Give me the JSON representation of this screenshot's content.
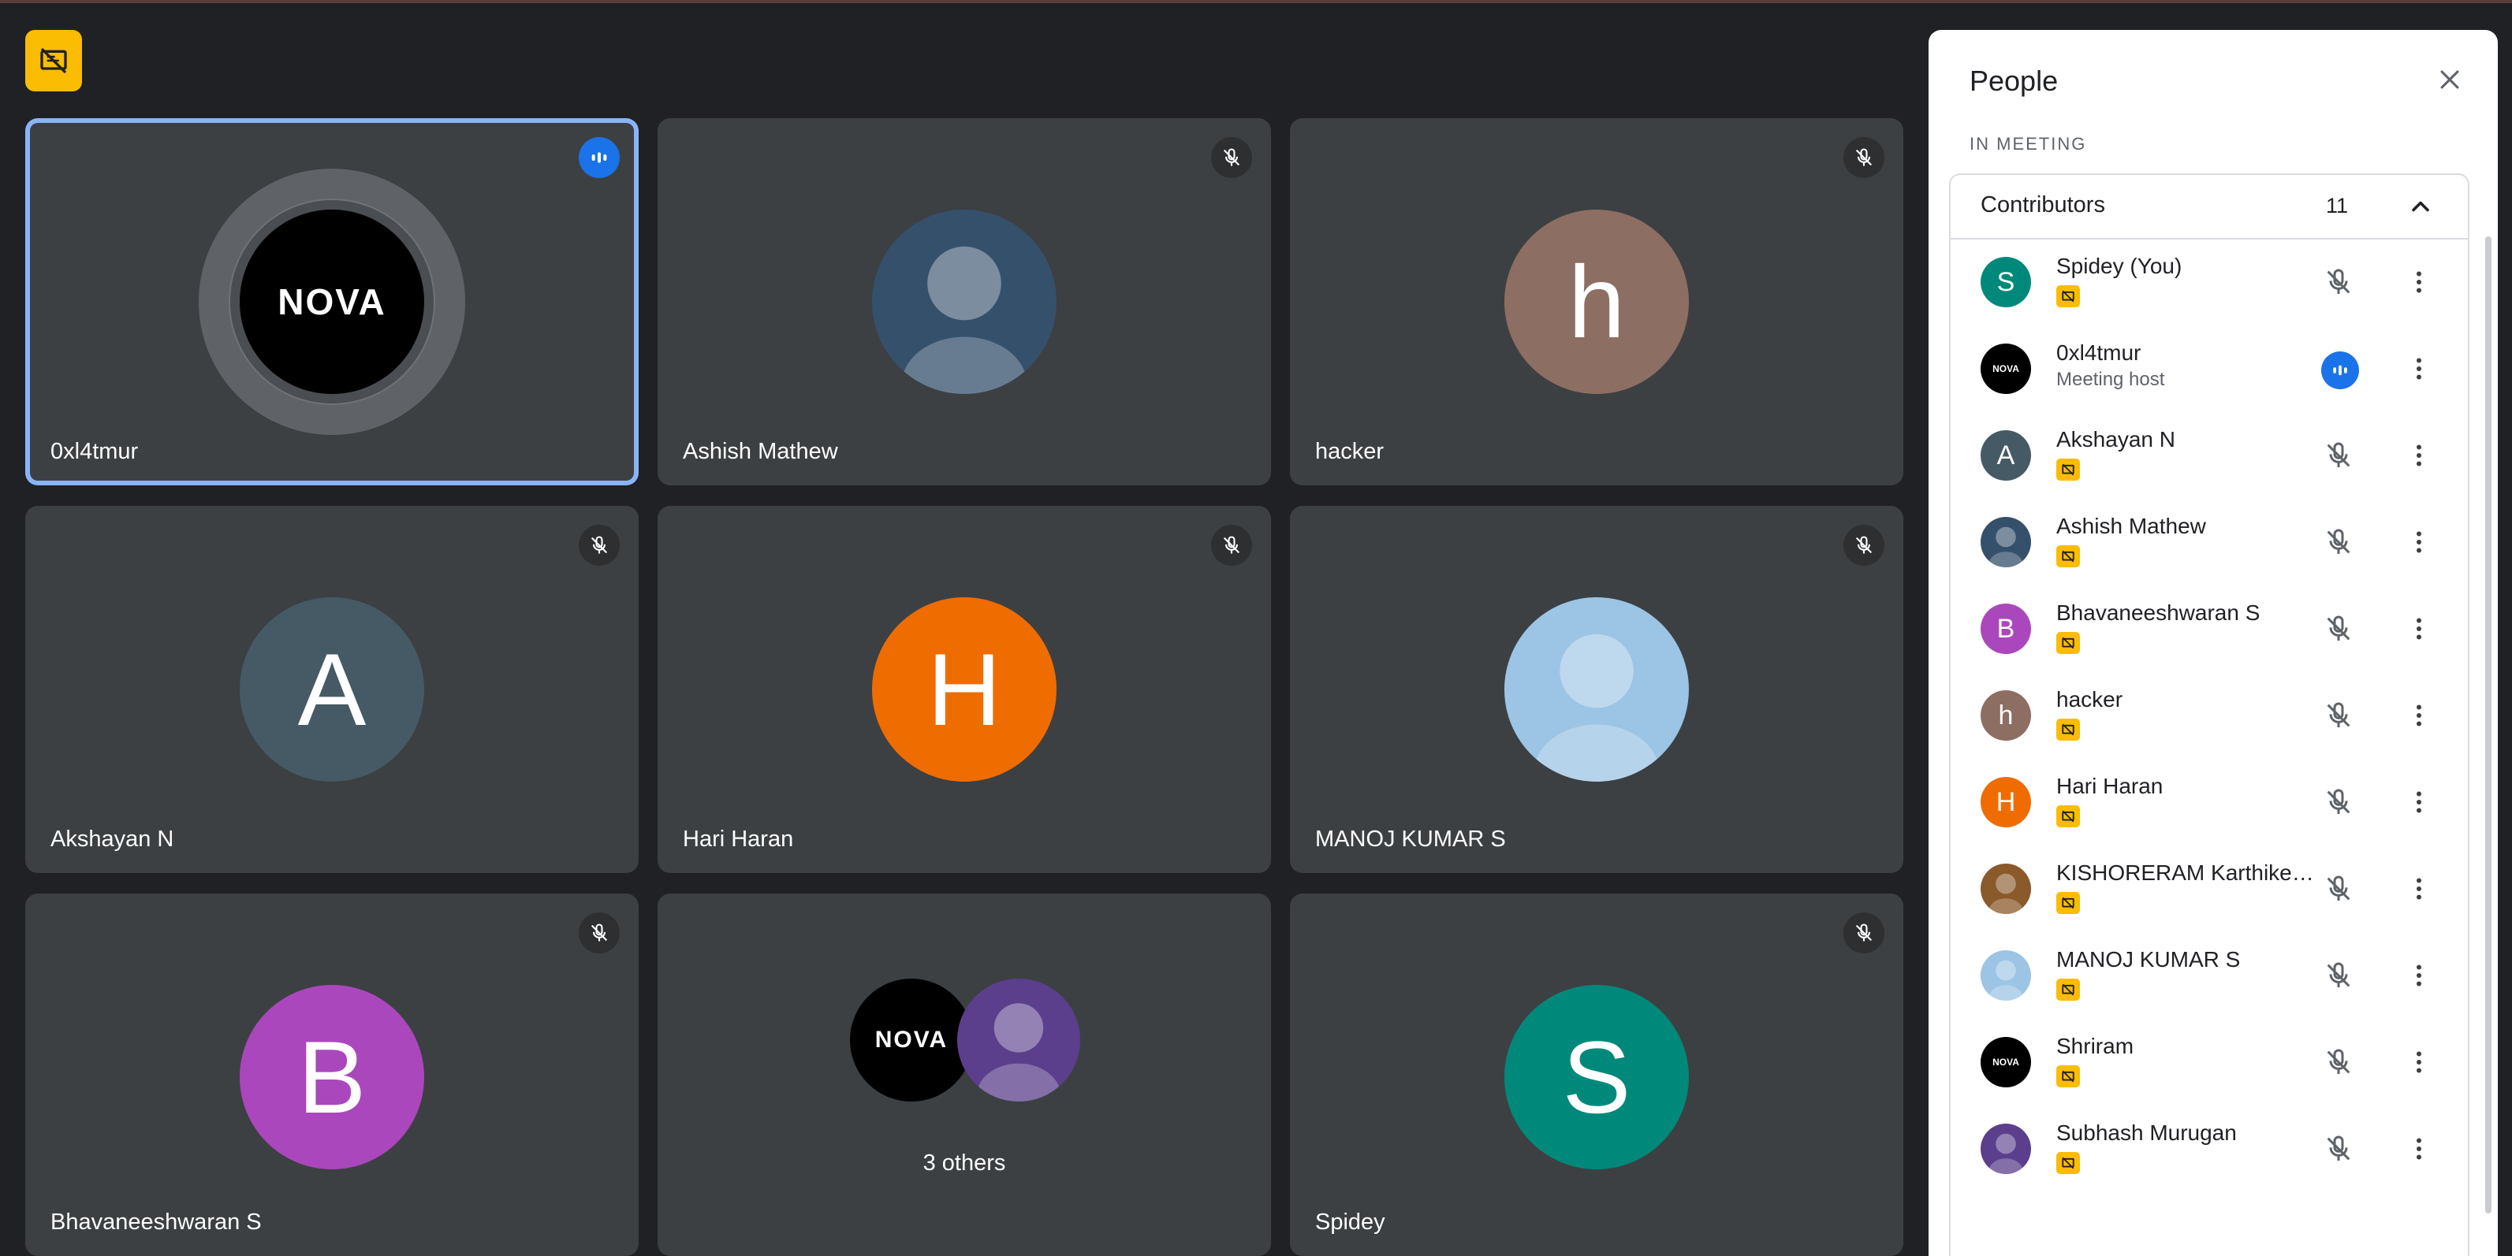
{
  "tiles": [
    {
      "name": "0xl4tmur",
      "avatar_type": "logo",
      "avatar_text": "NOVA",
      "status": "speaking",
      "active": true
    },
    {
      "name": "Ashish Mathew",
      "avatar_type": "image",
      "avatar_color": "#35506b",
      "status": "muted"
    },
    {
      "name": "hacker",
      "avatar_type": "letter",
      "avatar_text": "h",
      "avatar_color": "#8d6e63",
      "status": "muted"
    },
    {
      "name": "Akshayan N",
      "avatar_type": "letter",
      "avatar_text": "A",
      "avatar_color": "#455a64",
      "status": "muted"
    },
    {
      "name": "Hari Haran",
      "avatar_type": "letter",
      "avatar_text": "H",
      "avatar_color": "#ef6c00",
      "status": "muted"
    },
    {
      "name": "MANOJ KUMAR S",
      "avatar_type": "image",
      "avatar_color": "#9cc4e4",
      "status": "muted"
    },
    {
      "name": "Bhavaneeshwaran S",
      "avatar_type": "letter",
      "avatar_text": "B",
      "avatar_color": "#ab47bc",
      "status": "muted"
    },
    {
      "name": "",
      "avatar_type": "group",
      "group_label": "3 others",
      "status": "none"
    },
    {
      "name": "Spidey",
      "avatar_type": "letter",
      "avatar_text": "S",
      "avatar_color": "#00897b",
      "status": "muted"
    }
  ],
  "panel": {
    "title": "People",
    "section_label": "IN MEETING",
    "group_title": "Contributors",
    "group_count": "11"
  },
  "participants": [
    {
      "name": "Spidey (You)",
      "avatar_type": "letter",
      "avatar_text": "S",
      "avatar_color": "#00897b",
      "status": "muted",
      "badge": true
    },
    {
      "name": "0xl4tmur",
      "avatar_type": "logo",
      "avatar_text": "NOVA",
      "subtitle": "Meeting host",
      "status": "speaking",
      "badge": false
    },
    {
      "name": "Akshayan N",
      "avatar_type": "letter",
      "avatar_text": "A",
      "avatar_color": "#455a64",
      "status": "muted",
      "badge": true
    },
    {
      "name": "Ashish Mathew",
      "avatar_type": "image",
      "avatar_color": "#35506b",
      "status": "muted",
      "badge": true
    },
    {
      "name": "Bhavaneeshwaran S",
      "avatar_type": "letter",
      "avatar_text": "B",
      "avatar_color": "#ab47bc",
      "status": "muted",
      "badge": true
    },
    {
      "name": "hacker",
      "avatar_type": "letter",
      "avatar_text": "h",
      "avatar_color": "#8d6e63",
      "status": "muted",
      "badge": true
    },
    {
      "name": "Hari Haran",
      "avatar_type": "letter",
      "avatar_text": "H",
      "avatar_color": "#ef6c00",
      "status": "muted",
      "badge": true
    },
    {
      "name": "KISHORERAM Karthikey…",
      "avatar_type": "image",
      "avatar_color": "#8a5a2b",
      "status": "muted",
      "badge": true
    },
    {
      "name": "MANOJ KUMAR S",
      "avatar_type": "image",
      "avatar_color": "#9cc4e4",
      "status": "muted",
      "badge": true
    },
    {
      "name": "Shriram",
      "avatar_type": "logo",
      "avatar_text": "NOVA",
      "status": "muted",
      "badge": true
    },
    {
      "name": "Subhash Murugan",
      "avatar_type": "image",
      "avatar_color": "#5b3f8c",
      "status": "muted",
      "badge": true
    }
  ],
  "colors": {
    "background": "#202124",
    "tile": "#3c4043",
    "active_border": "#8ab4f8",
    "speaking": "#1a73e8",
    "badge": "#fbbc04"
  }
}
